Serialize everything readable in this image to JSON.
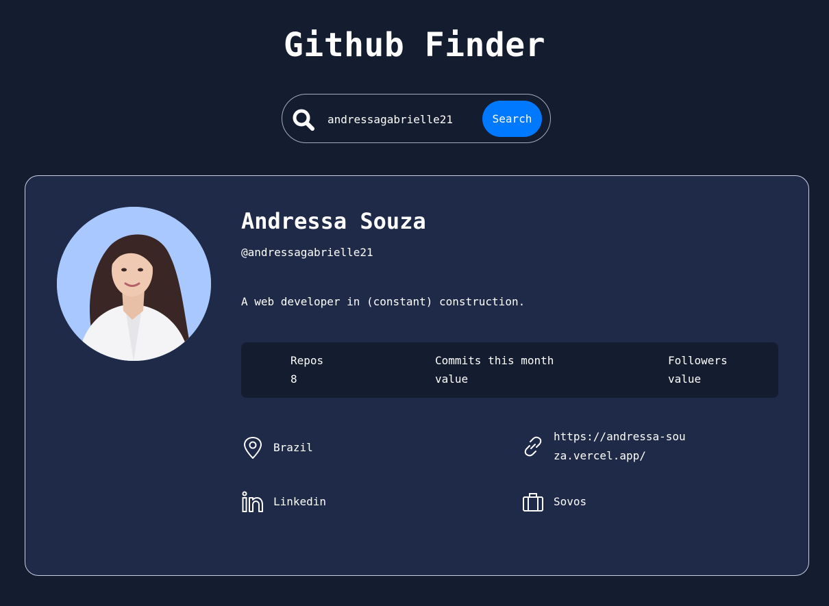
{
  "header": {
    "title": "Github Finder"
  },
  "search": {
    "value": "andressagabrielle21",
    "button_label": "Search",
    "icon": "search-icon"
  },
  "profile": {
    "name": "Andressa Souza",
    "login": "@andressagabrielle21",
    "bio": "A web developer in (constant) construction.",
    "stats": [
      {
        "label": "Repos",
        "value": "8"
      },
      {
        "label": "Commits this month",
        "value": "value"
      },
      {
        "label": "Followers",
        "value": "value"
      }
    ],
    "info": {
      "location": {
        "icon": "location-pin-icon",
        "text": "Brazil"
      },
      "website": {
        "icon": "link-icon",
        "text": "https://andressa-souza.vercel.app/"
      },
      "linkedin": {
        "icon": "linkedin-icon",
        "text": "Linkedin"
      },
      "company": {
        "icon": "briefcase-icon",
        "text": "Sovos"
      }
    }
  },
  "colors": {
    "background": "#141c2f",
    "card": "#1f2a48",
    "accent": "#0079ff",
    "avatar_bg": "#a9c8ff"
  }
}
